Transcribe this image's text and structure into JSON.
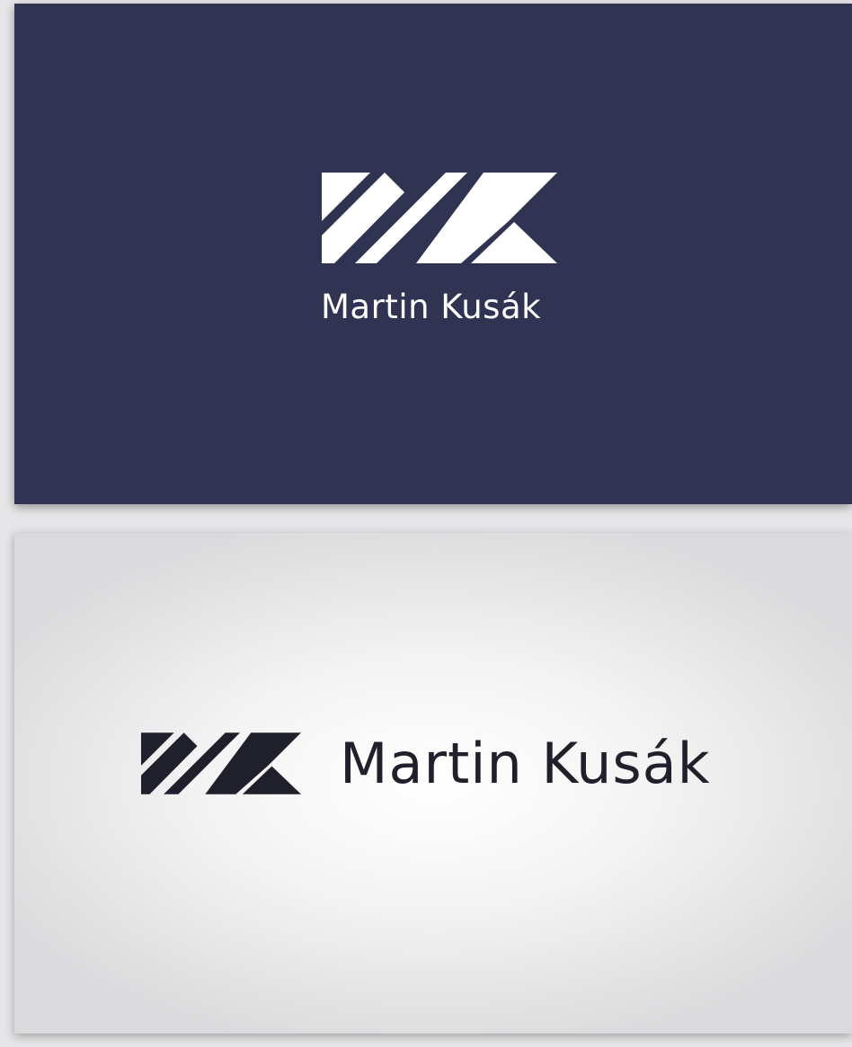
{
  "brand": {
    "name": "Martin Kusák"
  },
  "colors": {
    "navy": "#303352",
    "white": "#ffffff",
    "ink": "#1f202c"
  },
  "icons": {
    "logo": "mk-monogram-icon"
  }
}
